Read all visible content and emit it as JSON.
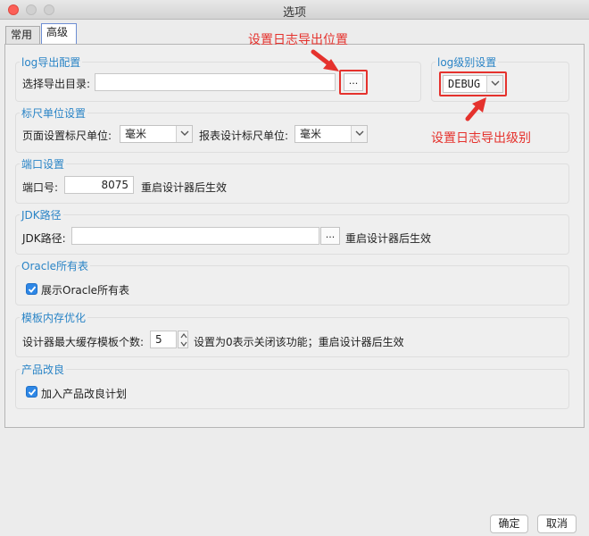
{
  "window": {
    "title": "选项"
  },
  "tabs": [
    {
      "label": "常用"
    },
    {
      "label": "高级"
    }
  ],
  "log_export": {
    "title": "log导出配置",
    "dir_label": "选择导出目录:",
    "dir_value": "",
    "browse_label": "..."
  },
  "log_level": {
    "title": "log级别设置",
    "selected": "DEBUG"
  },
  "ruler": {
    "title": "标尺单位设置",
    "page_label": "页面设置标尺单位:",
    "page_value": "毫米",
    "report_label": "报表设计标尺单位:",
    "report_value": "毫米"
  },
  "port": {
    "title": "端口设置",
    "label": "端口号:",
    "value": "8075",
    "note": "重启设计器后生效"
  },
  "jdk": {
    "title": "JDK路径",
    "label": "JDK路径:",
    "value": "",
    "browse_label": "...",
    "note": "重启设计器后生效"
  },
  "oracle": {
    "title": "Oracle所有表",
    "checkbox_label": "展示Oracle所有表",
    "checked": true
  },
  "template_cache": {
    "title": "模板内存优化",
    "label": "设计器最大缓存模板个数:",
    "value": "5",
    "note": "设置为0表示关闭该功能；重启设计器后生效"
  },
  "improve": {
    "title": "产品改良",
    "checkbox_label": "加入产品改良计划",
    "checked": true
  },
  "annotations": {
    "export_location": "设置日志导出位置",
    "export_level": "设置日志导出级别"
  },
  "colors": {
    "section_title": "#2a84c6",
    "annotation_red": "#e5322d",
    "checkbox_blue": "#2e87e6"
  },
  "footer": {
    "ok_label": "确定",
    "cancel_label": "取消"
  }
}
